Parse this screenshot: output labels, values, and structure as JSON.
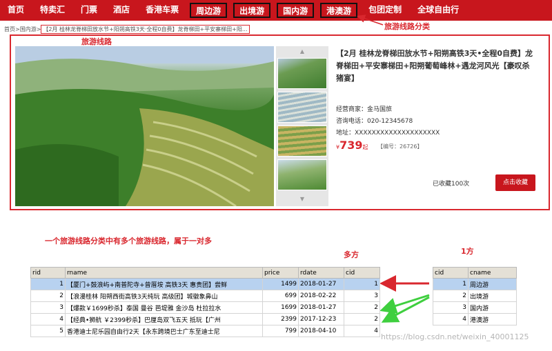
{
  "nav": {
    "items": [
      {
        "label": "首页",
        "boxed": false
      },
      {
        "label": "特卖汇",
        "boxed": false
      },
      {
        "label": "门票",
        "boxed": false
      },
      {
        "label": "酒店",
        "boxed": false
      },
      {
        "label": "香港车票",
        "boxed": false
      },
      {
        "label": "周边游",
        "boxed": true
      },
      {
        "label": "出境游",
        "boxed": true
      },
      {
        "label": "国内游",
        "boxed": true
      },
      {
        "label": "港澳游",
        "boxed": true
      },
      {
        "label": "包团定制",
        "boxed": false
      },
      {
        "label": "全球自由行",
        "boxed": false
      }
    ]
  },
  "annotations": {
    "category_label": "旅游线路分类",
    "route_label": "旅游线路",
    "relation_note": "一个旅游线路分类中有多个旅游线路，属于一对多",
    "many_side": "多方",
    "one_side": "1方"
  },
  "breadcrumb": {
    "home": "首页",
    "sep": ">",
    "category": "国内游",
    "current": "【2月 桂林龙脊梯田放水节+阳朔高铁3天·全程0自费】龙脊梯田+平安寨梯田+阳..."
  },
  "product": {
    "title": "【2月 桂林龙脊梯田放水节+阳朔高铁3天•全程0自费】龙脊梯田+平安寨梯田+阳朔葡萄峰林+遇龙河风光【豪叹杀猪宴】",
    "seller": "经营商家：金马国旅",
    "phone": "咨询电话：020-12345678",
    "address": "地址：XXXXXXXXXXXXXXXXXXXX",
    "currency": "¥",
    "price": "739",
    "price_suffix": "起",
    "code": "【编号：26726】",
    "favorite_count": "已收藏100次",
    "favorite_button": "点击收藏"
  },
  "route_table": {
    "headers": [
      "rid",
      "rname",
      "price",
      "rdate",
      "cid"
    ],
    "rows": [
      {
        "rid": "1",
        "rname": "【厦门+鼓浪屿+南普陀寺+曾厝垵 高铁3天 惠贵团】尝鲜",
        "price": "1499",
        "rdate": "2018-01-27",
        "cid": "1"
      },
      {
        "rid": "2",
        "rname": "【浪漫桂林 阳朔西街高铁3天纯玩 高级团】城徽象鼻山",
        "price": "699",
        "rdate": "2018-02-22",
        "cid": "3"
      },
      {
        "rid": "3",
        "rname": "【爆款￥1699秒杀】泰国 曼谷 芭堤雅 金沙岛 杜拉拉水",
        "price": "1699",
        "rdate": "2018-01-27",
        "cid": "2"
      },
      {
        "rid": "4",
        "rname": "【经典•狮航 ￥2399秒杀】巴厘岛双飞五天 抵玩【广州",
        "price": "2399",
        "rdate": "2017-12-23",
        "cid": "2"
      },
      {
        "rid": "5",
        "rname": "香港迪士尼乐园自由行2天【永东跨境巴士广东至迪士尼",
        "price": "799",
        "rdate": "2018-04-10",
        "cid": "4"
      }
    ]
  },
  "category_table": {
    "headers": [
      "cid",
      "cname"
    ],
    "rows": [
      {
        "cid": "1",
        "cname": "周边游"
      },
      {
        "cid": "2",
        "cname": "出境游"
      },
      {
        "cid": "3",
        "cname": "国内游"
      },
      {
        "cid": "4",
        "cname": "港澳游"
      }
    ]
  },
  "watermark": "https://blog.csdn.net/weixin_40001125",
  "colors": {
    "brand": "#c8161d",
    "annotation": "#d9272e",
    "arrow_green": "#3fcf3f"
  }
}
